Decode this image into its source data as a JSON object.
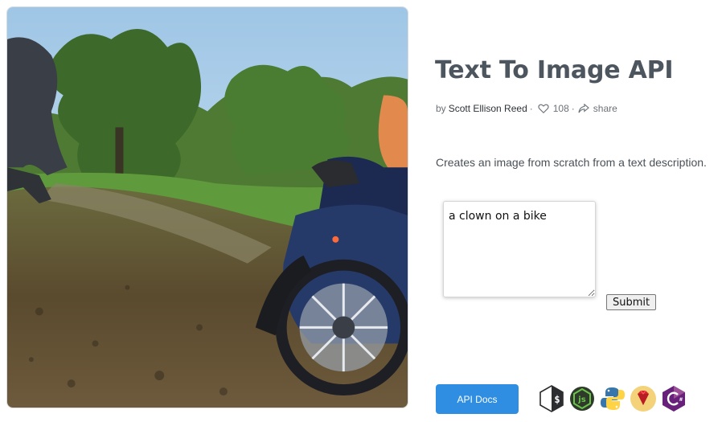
{
  "page": {
    "title": "Text To Image API",
    "description": "Creates an image from scratch from a text description."
  },
  "byline": {
    "prefix": "by",
    "author": "Scott Ellison Reed",
    "separator": "·",
    "likes": "108",
    "share_label": "share"
  },
  "form": {
    "prompt_value": "a clown on a bike",
    "submit_label": "Submit"
  },
  "footer": {
    "api_docs_label": "API Docs",
    "language_icons": [
      "shell-icon",
      "nodejs-icon",
      "python-icon",
      "ruby-icon",
      "csharp-icon"
    ]
  },
  "colors": {
    "accent": "#2f8ee1",
    "title": "#4d565f"
  }
}
